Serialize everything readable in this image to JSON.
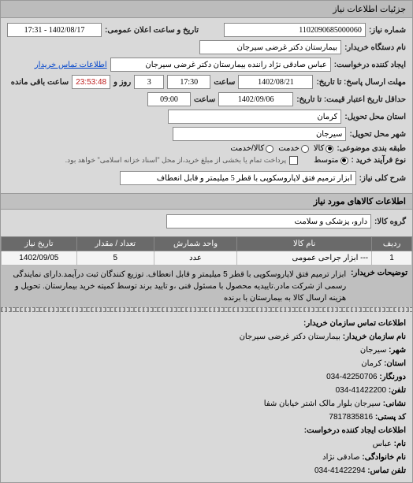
{
  "tab": {
    "title": "جزئیات اطلاعات نیاز"
  },
  "header": {
    "req_no_label": "شماره نیاز:",
    "req_no": "1102090685000060",
    "public_date_label": "تاریخ و ساعت اعلان عمومی:",
    "public_date": "1402/08/17 - 17:31",
    "buyer_name_label": "نام دستگاه خریدار:",
    "buyer_name": "بیمارستان دکتر غرضی سیرجان",
    "creator_label": "ایجاد کننده درخواست:",
    "creator": "عباس صادقی نژاد راننده بیمارستان دکتر غرضی سیرجان",
    "contact_link": "اطلاعات تماس خریدار"
  },
  "dates": {
    "deadline_label": "مهلت ارسال پاسخ: تا تاریخ:",
    "deadline_date": "1402/08/21",
    "deadline_time_label": "ساعت",
    "deadline_time": "17:30",
    "remaining_days": "3",
    "remaining_days_label": "روز و",
    "countdown": "23:53:48",
    "remaining_suffix": "ساعت باقی مانده",
    "validity_label": "حداقل تاریخ اعتبار قیمت: تا تاریخ:",
    "validity_date": "1402/09/06",
    "validity_time_label": "ساعت",
    "validity_time": "09:00"
  },
  "location": {
    "province_label": "استان محل تحویل:",
    "province": "کرمان",
    "city_label": "شهر محل تحویل:",
    "city": "سیرجان"
  },
  "category": {
    "label": "طبقه بندی موضوعی:",
    "options": [
      {
        "label": "کالا",
        "selected": true
      },
      {
        "label": "خدمت",
        "selected": false
      },
      {
        "label": "کالا/خدمت",
        "selected": false
      }
    ]
  },
  "process": {
    "label": "نوع فرآیند خرید :",
    "options": [
      {
        "label": "متوسط",
        "selected": true
      }
    ],
    "note_checkbox_label": "پرداخت تمام یا بخشی از مبلغ خرید،از محل \"اسناد خزانه اسلامی\" خواهد بود."
  },
  "need": {
    "title_label": "شرح کلی نیاز:",
    "title": "ابزار ترمیم فتق لاپاروسکوپی با قطر 5 میلیمتر و قابل انعطاف"
  },
  "goods_section_title": "اطلاعات کالاهای مورد نیاز",
  "group": {
    "label": "گروه کالا:",
    "value": "دارو، پزشکی و سلامت"
  },
  "table": {
    "headers": [
      "ردیف",
      "نام کالا",
      "واحد شمارش",
      "تعداد / مقدار",
      "تاریخ نیاز"
    ],
    "rows": [
      {
        "idx": "1",
        "name": "--- ابزار جراحی عمومی",
        "unit": "عدد",
        "qty": "5",
        "date": "1402/09/05"
      }
    ]
  },
  "buyer_desc": {
    "label": "توضیحات خریدار:",
    "text": "ابزار ترمیم فتق لاپاروسکوپی با قطر 5 میلیمتر و قابل انعطاف. توزیع کنندگان ثبت درآیمد.دارای نمایندگی رسمی از شرکت مادر.تاییدیه محصول با مسئول فنی ،و تایید برند توسط کمیته خرید بیمارستان. تحویل و هزینه ارسال کالا به بیمارستان با برنده"
  },
  "contact": {
    "section_title": "اطلاعات تماس سازمان خریدار:",
    "org_label": "نام سازمان خریدار:",
    "org": "بیمارستان دکتر غرضی سیرجان",
    "city_label": "شهر:",
    "city": "سیرجان",
    "province_label": "استان:",
    "province": "کرمان",
    "fax_label": "دورنگار:",
    "fax": "42250706-034",
    "phone_label": "تلفن:",
    "phone": "41422200-034",
    "address_label": "نشانی:",
    "address": "سیرجان بلوار مالک اشتر خیابان شفا",
    "postal_label": "کد پستی:",
    "postal": "7817835816",
    "req_creator_title": "اطلاعات ایجاد کننده درخواست:",
    "name_label": "نام:",
    "name": "عباس",
    "lastname_label": "نام خانوادگی:",
    "lastname": "صادقی نژاد",
    "cphone_label": "تلفن تماس:",
    "cphone": "41422294-034"
  }
}
